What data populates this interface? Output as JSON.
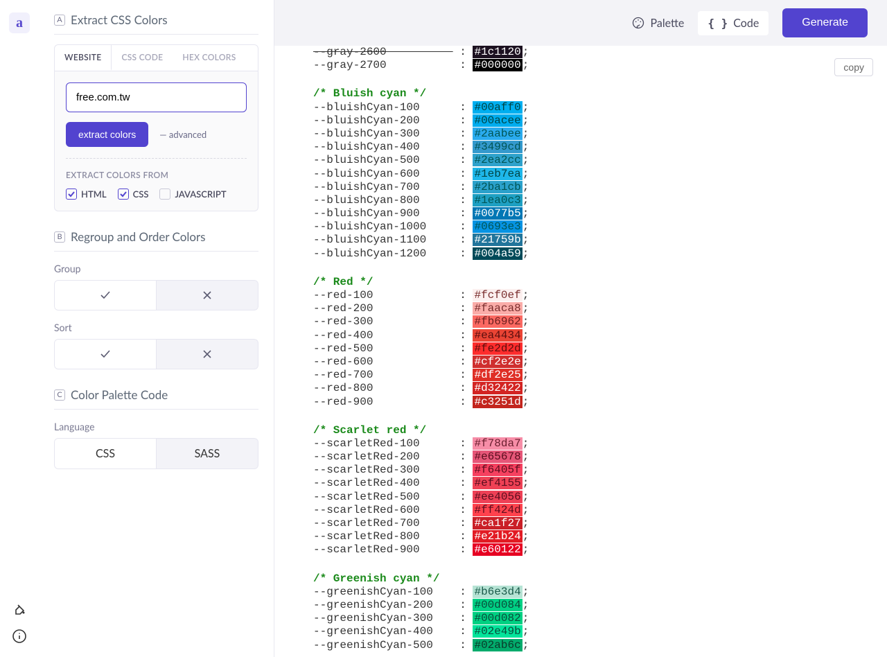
{
  "logo": "a",
  "topbar": {
    "palette": "Palette",
    "code": "Code",
    "generate": "Generate"
  },
  "copy": "copy",
  "sectionA": {
    "badge": "A",
    "title": "Extract CSS Colors",
    "tabs": {
      "website": "WEBSITE",
      "css": "CSS CODE",
      "hex": "HEX COLORS"
    },
    "input": "free.com.tw",
    "extractBtn": "extract colors",
    "advanced": "advanced",
    "fromLabel": "EXTRACT COLORS FROM",
    "checks": {
      "html": "HTML",
      "css": "CSS",
      "js": "JAVASCRIPT"
    }
  },
  "sectionB": {
    "badge": "B",
    "title": "Regroup and Order Colors",
    "group": "Group",
    "sort": "Sort"
  },
  "sectionC": {
    "badge": "C",
    "title": "Color Palette Code",
    "language": "Language",
    "css": "CSS",
    "sass": "SASS"
  },
  "code": {
    "leadingVars": [
      {
        "name": "--gray-2600",
        "hex": "#1c1120",
        "bg": "#1c1120",
        "fg": "#fff",
        "strike": true
      },
      {
        "name": "--gray-2700",
        "hex": "#000000",
        "bg": "#000000",
        "fg": "#fff"
      }
    ],
    "groups": [
      {
        "comment": "/* Bluish cyan */",
        "vars": [
          {
            "name": "--bluishCyan-100",
            "hex": "#00aff0",
            "bg": "#00aff0",
            "fg": "#044"
          },
          {
            "name": "--bluishCyan-200",
            "hex": "#00acee",
            "bg": "#00acee",
            "fg": "#044"
          },
          {
            "name": "--bluishCyan-300",
            "hex": "#2aabee",
            "bg": "#2aabee",
            "fg": "#055"
          },
          {
            "name": "--bluishCyan-400",
            "hex": "#3499cd",
            "bg": "#3499cd",
            "fg": "#055"
          },
          {
            "name": "--bluishCyan-500",
            "hex": "#2ea2cc",
            "bg": "#2ea2cc",
            "fg": "#055"
          },
          {
            "name": "--bluishCyan-600",
            "hex": "#1eb7ea",
            "bg": "#1eb7ea",
            "fg": "#044"
          },
          {
            "name": "--bluishCyan-700",
            "hex": "#2ba1cb",
            "bg": "#2ba1cb",
            "fg": "#055"
          },
          {
            "name": "--bluishCyan-800",
            "hex": "#1ea0c3",
            "bg": "#1ea0c3",
            "fg": "#055"
          },
          {
            "name": "--bluishCyan-900",
            "hex": "#0077b5",
            "bg": "#0077b5",
            "fg": "#fff"
          },
          {
            "name": "--bluishCyan-1000",
            "hex": "#0693e3",
            "bg": "#0693e3",
            "fg": "#055"
          },
          {
            "name": "--bluishCyan-1100",
            "hex": "#21759b",
            "bg": "#21759b",
            "fg": "#fff"
          },
          {
            "name": "--bluishCyan-1200",
            "hex": "#004a59",
            "bg": "#004a59",
            "fg": "#fff"
          }
        ]
      },
      {
        "comment": "/* Red */",
        "vars": [
          {
            "name": "--red-100",
            "hex": "#fcf0ef",
            "bg": "#fcf0ef",
            "fg": "#7a2e2e"
          },
          {
            "name": "--red-200",
            "hex": "#faaca8",
            "bg": "#faaca8",
            "fg": "#7a2e2e"
          },
          {
            "name": "--red-300",
            "hex": "#fb6962",
            "bg": "#fb6962",
            "fg": "#6a1e1e"
          },
          {
            "name": "--red-400",
            "hex": "#ea4434",
            "bg": "#ea4434",
            "fg": "#5a0e0e"
          },
          {
            "name": "--red-500",
            "hex": "#fe2d2d",
            "bg": "#fe2d2d",
            "fg": "#5a0e0e"
          },
          {
            "name": "--red-600",
            "hex": "#cf2e2e",
            "bg": "#cf2e2e",
            "fg": "#fff"
          },
          {
            "name": "--red-700",
            "hex": "#df2e25",
            "bg": "#df2e25",
            "fg": "#fff"
          },
          {
            "name": "--red-800",
            "hex": "#d32422",
            "bg": "#d32422",
            "fg": "#fff"
          },
          {
            "name": "--red-900",
            "hex": "#c3251d",
            "bg": "#c3251d",
            "fg": "#fff"
          }
        ]
      },
      {
        "comment": "/* Scarlet red */",
        "vars": [
          {
            "name": "--scarletRed-100",
            "hex": "#f78da7",
            "bg": "#f78da7",
            "fg": "#6a1e2e"
          },
          {
            "name": "--scarletRed-200",
            "hex": "#e65678",
            "bg": "#e65678",
            "fg": "#5a0e1e"
          },
          {
            "name": "--scarletRed-300",
            "hex": "#f6405f",
            "bg": "#f6405f",
            "fg": "#5a0e1e"
          },
          {
            "name": "--scarletRed-400",
            "hex": "#ef4155",
            "bg": "#ef4155",
            "fg": "#5a0e1e"
          },
          {
            "name": "--scarletRed-500",
            "hex": "#ee4056",
            "bg": "#ee4056",
            "fg": "#5a0e1e"
          },
          {
            "name": "--scarletRed-600",
            "hex": "#ff424d",
            "bg": "#ff424d",
            "fg": "#5a0e1e"
          },
          {
            "name": "--scarletRed-700",
            "hex": "#ca1f27",
            "bg": "#ca1f27",
            "fg": "#fff"
          },
          {
            "name": "--scarletRed-800",
            "hex": "#e21b24",
            "bg": "#e21b24",
            "fg": "#fff"
          },
          {
            "name": "--scarletRed-900",
            "hex": "#e60122",
            "bg": "#e60122",
            "fg": "#fff"
          }
        ]
      },
      {
        "comment": "/* Greenish cyan */",
        "vars": [
          {
            "name": "--greenishCyan-100",
            "hex": "#b6e3d4",
            "bg": "#b6e3d4",
            "fg": "#1a5a4a"
          },
          {
            "name": "--greenishCyan-200",
            "hex": "#00d084",
            "bg": "#00d084",
            "fg": "#0a4a3a"
          },
          {
            "name": "--greenishCyan-300",
            "hex": "#00d082",
            "bg": "#00d082",
            "fg": "#0a4a3a"
          },
          {
            "name": "--greenishCyan-400",
            "hex": "#02e49b",
            "bg": "#02e49b",
            "fg": "#0a4a3a"
          },
          {
            "name": "--greenishCyan-500",
            "hex": "#02ab6c",
            "bg": "#02ab6c",
            "fg": "#0a3a2a"
          }
        ]
      }
    ]
  }
}
